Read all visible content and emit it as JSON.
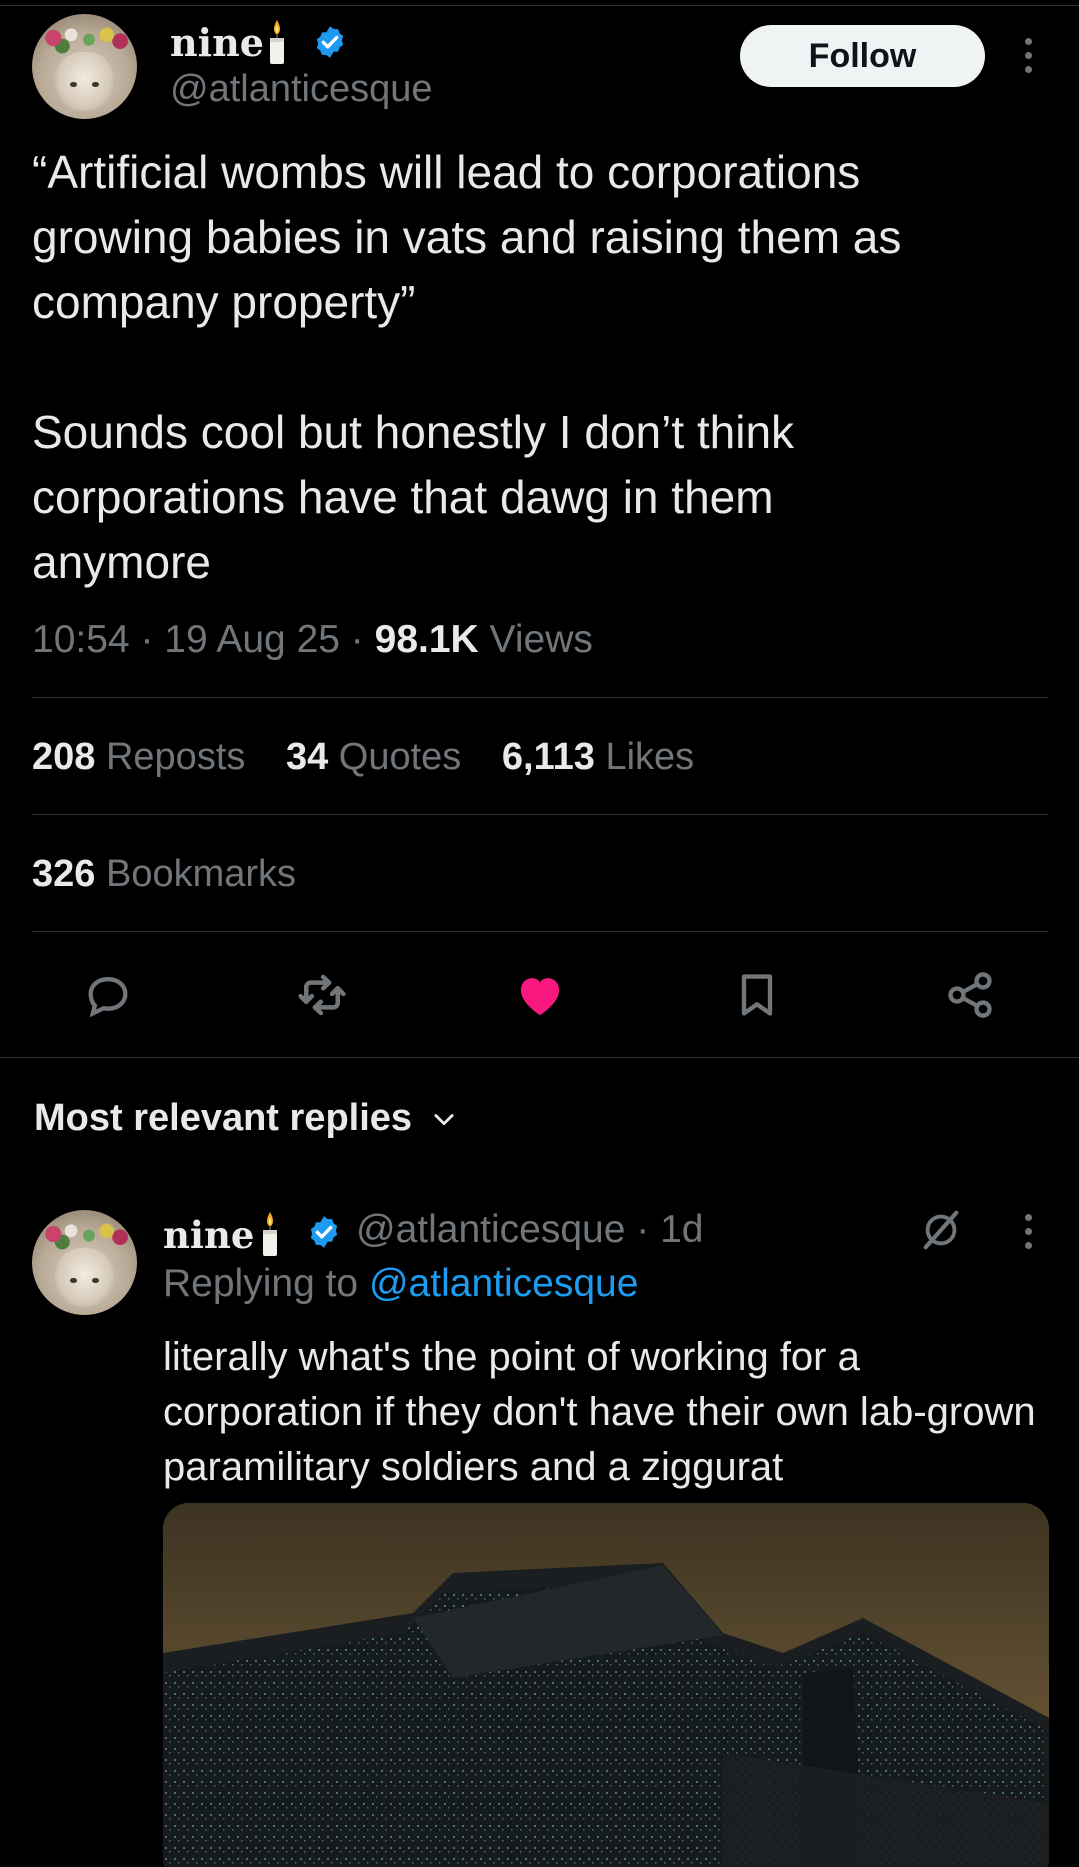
{
  "tweet": {
    "author_name": "nine",
    "handle": "@atlanticesque",
    "follow_label": "Follow",
    "text": "“Artificial wombs will lead to corporations\ngrowing babies in vats and raising them as\ncompany property”\n\nSounds cool but honestly I don’t think\ncorporations have that dawg in them\nanymore",
    "time": "10:54",
    "date": "19 Aug 25",
    "views_count": "98.1K",
    "views_label": "Views",
    "reposts_count": "208",
    "reposts_label": "Reposts",
    "quotes_count": "34",
    "quotes_label": "Quotes",
    "likes_count": "6,113",
    "likes_label": "Likes",
    "bookmarks_count": "326",
    "bookmarks_label": "Bookmarks",
    "liked": true
  },
  "actions": [
    "reply-icon",
    "repost-icon",
    "like-icon",
    "bookmark-icon",
    "share-icon"
  ],
  "replies_section": {
    "title": "Most relevant replies"
  },
  "reply": {
    "author_name": "nine",
    "handle": "@atlanticesque",
    "age": "1d",
    "replying_prefix": "Replying to",
    "replying_to": "@atlanticesque",
    "text": "literally what's the point of working for a corporation if they don't have their own lab-grown paramilitary soldiers and a ziggurat"
  },
  "colors": {
    "background": "#000000",
    "text": "#e7e9ea",
    "muted": "#71767b",
    "accent": "#1d9bf0",
    "like": "#f91880",
    "divider": "#2f3336"
  }
}
